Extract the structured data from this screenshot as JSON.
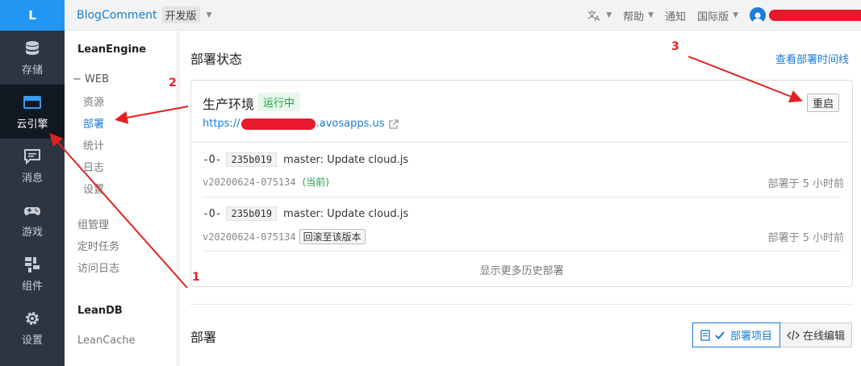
{
  "rail": {
    "logo": "L",
    "items": [
      {
        "label": "存储",
        "icon": "database-icon"
      },
      {
        "label": "云引擎",
        "icon": "cloud-engine-icon"
      },
      {
        "label": "消息",
        "icon": "message-icon"
      },
      {
        "label": "游戏",
        "icon": "gamepad-icon"
      },
      {
        "label": "组件",
        "icon": "components-icon"
      },
      {
        "label": "设置",
        "icon": "gear-icon"
      }
    ]
  },
  "topbar": {
    "app_name": "BlogComment",
    "env": "开发版",
    "translate_icon": "translate-icon",
    "help": "帮助",
    "notice": "通知",
    "region": "国际版"
  },
  "subnav": {
    "leanengine": "LeanEngine",
    "web": "WEB",
    "items": [
      "资源",
      "部署",
      "统计",
      "日志",
      "设置"
    ],
    "group_mgmt": "组管理",
    "cron": "定时任务",
    "access_log": "访问日志",
    "leandb": "LeanDB",
    "leancache": "LeanCache"
  },
  "main": {
    "status_title": "部署状态",
    "timeline_link": "查看部署时间线",
    "env_title": "生产环境",
    "status": "运行中",
    "restart": "重启",
    "url_prefix": "https://",
    "url_suffix": ".avosapps.us",
    "deployments": [
      {
        "hash": "235b019",
        "message": "master: Update cloud.js",
        "version": "v20200624-075134",
        "current": "(当前)",
        "time": "部署于 5 小时前"
      },
      {
        "hash": "235b019",
        "message": "master: Update cloud.js",
        "version": "v20200624-075134",
        "rollback": "回滚至该版本",
        "time": "部署于 5 小时前"
      }
    ],
    "more": "显示更多历史部署",
    "deploy_title": "部署",
    "deploy_project": "部署项目",
    "online_edit": "在线编辑"
  },
  "annotations": [
    "1",
    "2",
    "3"
  ],
  "colors": {
    "accent": "#1a7bd5",
    "arrow": "#e02020",
    "running": "#22a046"
  }
}
